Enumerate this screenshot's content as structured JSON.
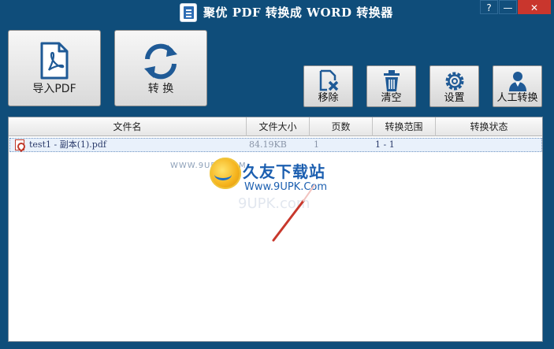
{
  "window": {
    "title": "聚优 PDF 转换成 WORD 转换器",
    "help_label": "?",
    "minimize_label": "—",
    "close_label": "✕"
  },
  "toolbar": {
    "import_label": "导入PDF",
    "convert_label": "转 换",
    "remove_label": "移除",
    "clear_label": "清空",
    "settings_label": "设置",
    "manual_label": "人工转换"
  },
  "table": {
    "headers": {
      "name": "文件名",
      "size": "文件大小",
      "pages": "页数",
      "range": "转换范围",
      "status": "转换状态"
    },
    "rows": [
      {
        "name": "test1 - 副本(1).pdf",
        "size": "84.19KB",
        "pages": "1",
        "range": "1 - 1",
        "status": ""
      }
    ]
  },
  "watermark": {
    "www": "WWW.9UPK.COM",
    "brand": "久友下载站",
    "url": "Www.9UPK.Com",
    "ghost": "9UPK.com"
  },
  "colors": {
    "background": "#0f4d7a",
    "close_button": "#c9362d",
    "icon_blue": "#1f5a96",
    "pdf_red": "#c03a2b"
  }
}
